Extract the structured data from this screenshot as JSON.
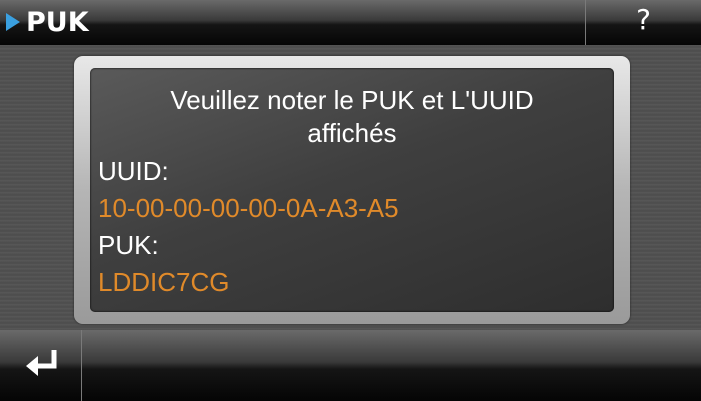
{
  "header": {
    "title": "PUK",
    "help_label": "?"
  },
  "dialog": {
    "message_line1": "Veuillez noter le PUK et L'UUID",
    "message_line2": "affichés",
    "uuid_label": "UUID:",
    "uuid_value": "10-00-00-00-00-0A-A3-A5",
    "puk_label": "PUK:",
    "puk_value": "LDDIC7CG"
  },
  "colors": {
    "accent_arrow": "#3aa0e0",
    "value_text": "#e08a2a"
  },
  "footer": {
    "back_icon": "return-arrow-icon"
  }
}
